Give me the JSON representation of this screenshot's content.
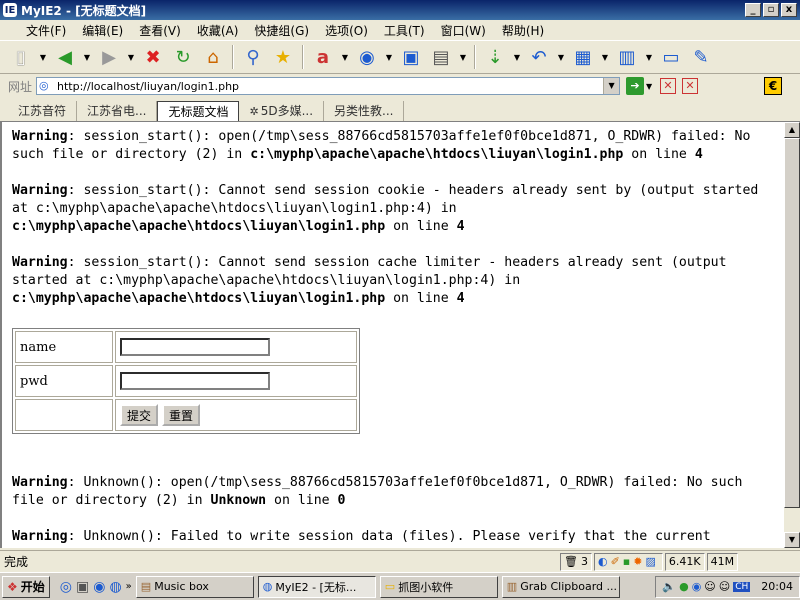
{
  "window": {
    "app_icon": "IE",
    "title": "MyIE2 - [无标题文档]",
    "controls": [
      "_",
      "▫",
      "x"
    ]
  },
  "menu": [
    "文件(F)",
    "编辑(E)",
    "查看(V)",
    "收藏(A)",
    "快捷组(G)",
    "选项(O)",
    "工具(T)",
    "窗口(W)",
    "帮助(H)"
  ],
  "toolbar_icons": [
    "new-page-icon",
    "back-icon",
    "forward-icon",
    "stop-icon",
    "refresh-icon",
    "home-icon",
    "search-icon",
    "favorites-icon",
    "font-icon",
    "globe-icon",
    "window-icon",
    "print-icon",
    "download-icon",
    "undo-icon",
    "grid-icon",
    "columns-icon",
    "save-icon",
    "edit-icon"
  ],
  "address": {
    "label": "网址",
    "url": "http://localhost/liuyan/login1.php"
  },
  "tabs": [
    {
      "label": "江苏音符",
      "active": false
    },
    {
      "label": "江苏省电...",
      "active": false
    },
    {
      "label": "无标题文档",
      "active": true
    },
    {
      "label": "5D多媒...",
      "active": false
    },
    {
      "label": "另类性教...",
      "active": false
    }
  ],
  "warnings": {
    "w1": {
      "label": "Warning",
      "l1": ": session_start(): open(/tmp\\sess_88766cd5815703affe1ef0f0bce1d871, O_RDWR) failed: No",
      "l2": "such file or directory (2) in ",
      "path": "c:\\myphp\\apache\\apache\\htdocs\\liuyan\\login1.php",
      "on": " on line ",
      "line": "4"
    },
    "w2": {
      "label": "Warning",
      "l1": ": session_start(): Cannot send session cookie - headers already sent by (output started",
      "l2": "at c:\\myphp\\apache\\apache\\htdocs\\liuyan\\login1.php:4) in",
      "path": "c:\\myphp\\apache\\apache\\htdocs\\liuyan\\login1.php",
      "on": " on line ",
      "line": "4"
    },
    "w3": {
      "label": "Warning",
      "l1": ": session_start(): Cannot send session cache limiter - headers already sent (output",
      "l2": "started at c:\\myphp\\apache\\apache\\htdocs\\liuyan\\login1.php:4) in",
      "path": "c:\\myphp\\apache\\apache\\htdocs\\liuyan\\login1.php",
      "on": " on line ",
      "line": "4"
    },
    "w4": {
      "label": "Warning",
      "l1": ": Unknown(): open(/tmp\\sess_88766cd5815703affe1ef0f0bce1d871, O_RDWR) failed: No such",
      "l2": "file or directory (2) in ",
      "path": "Unknown",
      "on": " on line ",
      "line": "0"
    },
    "w5": {
      "label": "Warning",
      "l1": ": Unknown(): Failed to write session data (files). Please verify that the current"
    }
  },
  "form": {
    "name_label": "name",
    "name_value": "",
    "pwd_label": "pwd",
    "pwd_value": "",
    "submit_label": "提交",
    "reset_label": "重置"
  },
  "status": {
    "text": "完成",
    "count": "3",
    "size": "6.41K",
    "mem": "41M"
  },
  "taskbar": {
    "start": "开始",
    "tasks": [
      {
        "label": "Music box",
        "active": false
      },
      {
        "label": "MyIE2 - [无标...",
        "active": true
      },
      {
        "label": "抓图小软件",
        "active": false
      },
      {
        "label": "Grab Clipboard ...",
        "active": false
      }
    ],
    "ime": "CH",
    "clock": "20:04"
  }
}
